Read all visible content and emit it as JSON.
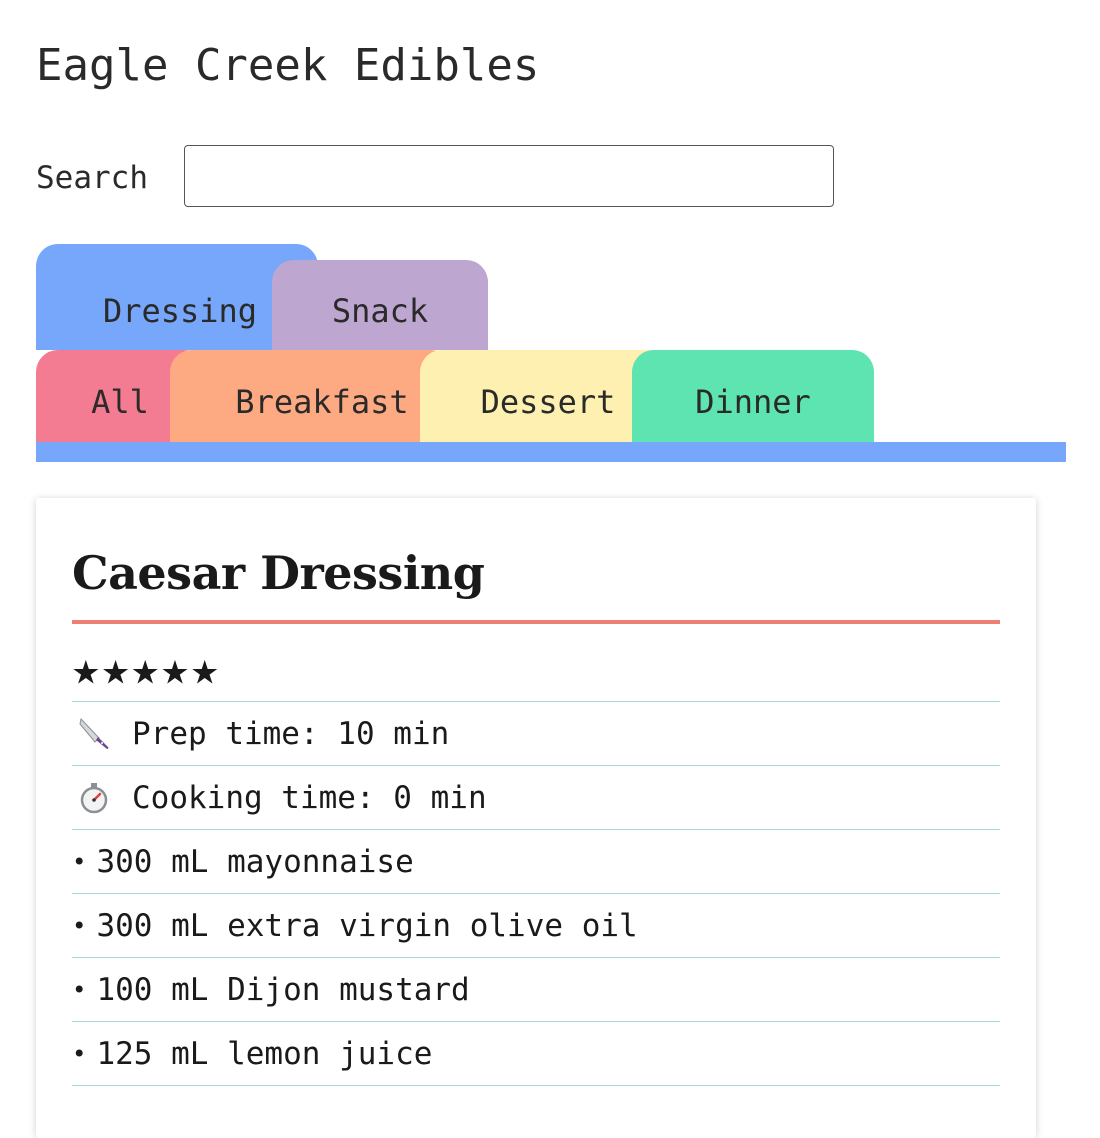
{
  "app": {
    "title": "Eagle Creek Edibles"
  },
  "search": {
    "label": "Search",
    "value": "",
    "placeholder": ""
  },
  "tabs": [
    {
      "label": "Dressing",
      "color": "#76a7fa",
      "selected": true
    },
    {
      "label": "Snack",
      "color": "#bda6d0"
    },
    {
      "label": "All",
      "color": "#f47c92"
    },
    {
      "label": "Breakfast",
      "color": "#fdaa83"
    },
    {
      "label": "Dessert",
      "color": "#fdf0b1"
    },
    {
      "label": "Dinner",
      "color": "#5de4b0"
    }
  ],
  "recipe": {
    "title": "Caesar Dressing",
    "rating": 5,
    "rating_max": 5,
    "star_glyph": "★",
    "prep_time": "Prep time: 10 min",
    "prep_icon": "knife-icon",
    "cook_time": "Cooking time: 0 min",
    "cook_icon": "stopwatch-icon",
    "ingredients": [
      "300 mL mayonnaise",
      "300 mL extra virgin olive oil",
      "100 mL Dijon mustard",
      "125 mL lemon juice"
    ],
    "bullet": "•"
  },
  "colors": {
    "title_underline": "#ee7f73",
    "row_divider": "#a9d5dd",
    "active_tab_bar": "#76a7fa"
  }
}
